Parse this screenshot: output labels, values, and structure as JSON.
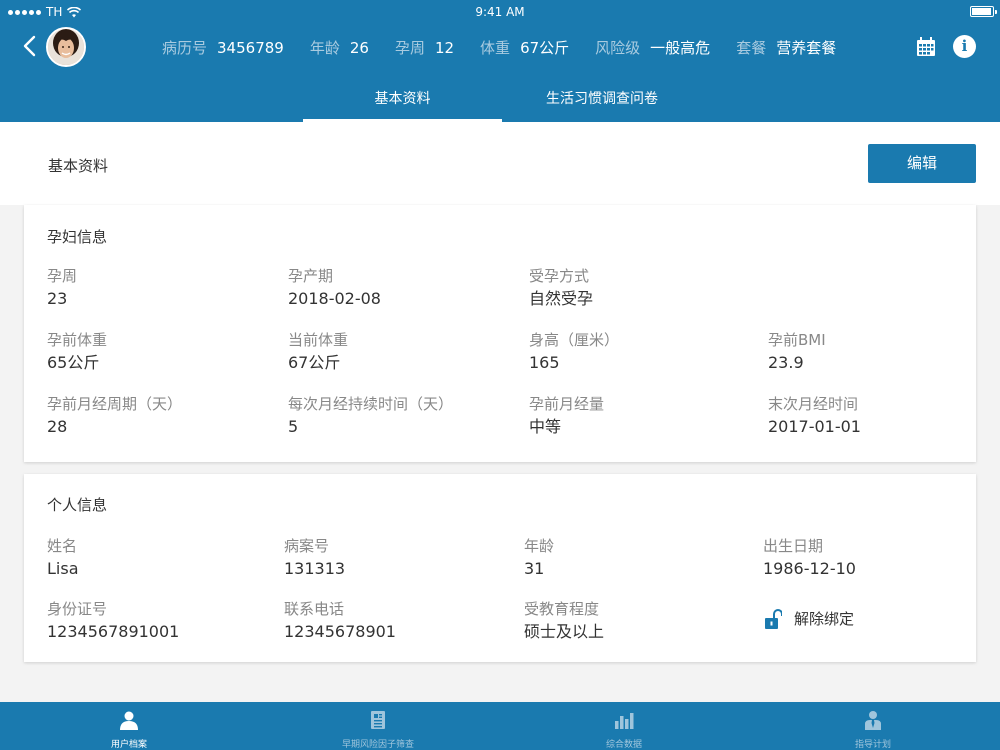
{
  "status": {
    "carrier": "TH",
    "time": "9:41 AM"
  },
  "patient": [
    {
      "label": "病历号",
      "value": "3456789"
    },
    {
      "label": "年龄",
      "value": "26"
    },
    {
      "label": "孕周",
      "value": "12"
    },
    {
      "label": "体重",
      "value": "67公斤"
    },
    {
      "label": "风险级",
      "value": "一般高危"
    },
    {
      "label": "套餐",
      "value": "营养套餐"
    }
  ],
  "tabs": [
    {
      "label": "基本资料",
      "active": true
    },
    {
      "label": "生活习惯调查问卷",
      "active": false
    }
  ],
  "page": {
    "title": "基本资料",
    "edit_label": "编辑"
  },
  "pregnancy": {
    "title": "孕妇信息",
    "fields": [
      {
        "label": "孕周",
        "value": "23"
      },
      {
        "label": "孕产期",
        "value": "2018-02-08"
      },
      {
        "label": "受孕方式",
        "value": "自然受孕"
      },
      {
        "label": "孕前体重",
        "value": "65公斤"
      },
      {
        "label": "当前体重",
        "value": "67公斤"
      },
      {
        "label": "身高（厘米）",
        "value": "165"
      },
      {
        "label": "孕前BMI",
        "value": "23.9"
      },
      {
        "label": "孕前月经周期（天）",
        "value": "28"
      },
      {
        "label": "每次月经持续时间（天）",
        "value": "5"
      },
      {
        "label": "孕前月经量",
        "value": "中等"
      },
      {
        "label": "末次月经时间",
        "value": "2017-01-01"
      }
    ]
  },
  "personal": {
    "title": "个人信息",
    "fields": [
      {
        "label": "姓名",
        "value": "Lisa"
      },
      {
        "label": "病案号",
        "value": "131313"
      },
      {
        "label": "年龄",
        "value": "31"
      },
      {
        "label": "出生日期",
        "value": "1986-12-10"
      },
      {
        "label": "身份证号",
        "value": "1234567891001"
      },
      {
        "label": "联系电话",
        "value": "12345678901"
      },
      {
        "label": "受教育程度",
        "value": "硕士及以上"
      }
    ],
    "unbind_label": "解除绑定"
  },
  "bottom_tabs": [
    {
      "label": "用户档案",
      "icon": "user-icon",
      "active": true
    },
    {
      "label": "早期风险因子筛查",
      "icon": "document-icon",
      "active": false
    },
    {
      "label": "综合数据",
      "icon": "bar-chart-icon",
      "active": false
    },
    {
      "label": "指导计划",
      "icon": "person-tie-icon",
      "active": false
    }
  ],
  "colors": {
    "primary": "#1a7aaf",
    "inactive_tab": "#9fc5dc"
  }
}
